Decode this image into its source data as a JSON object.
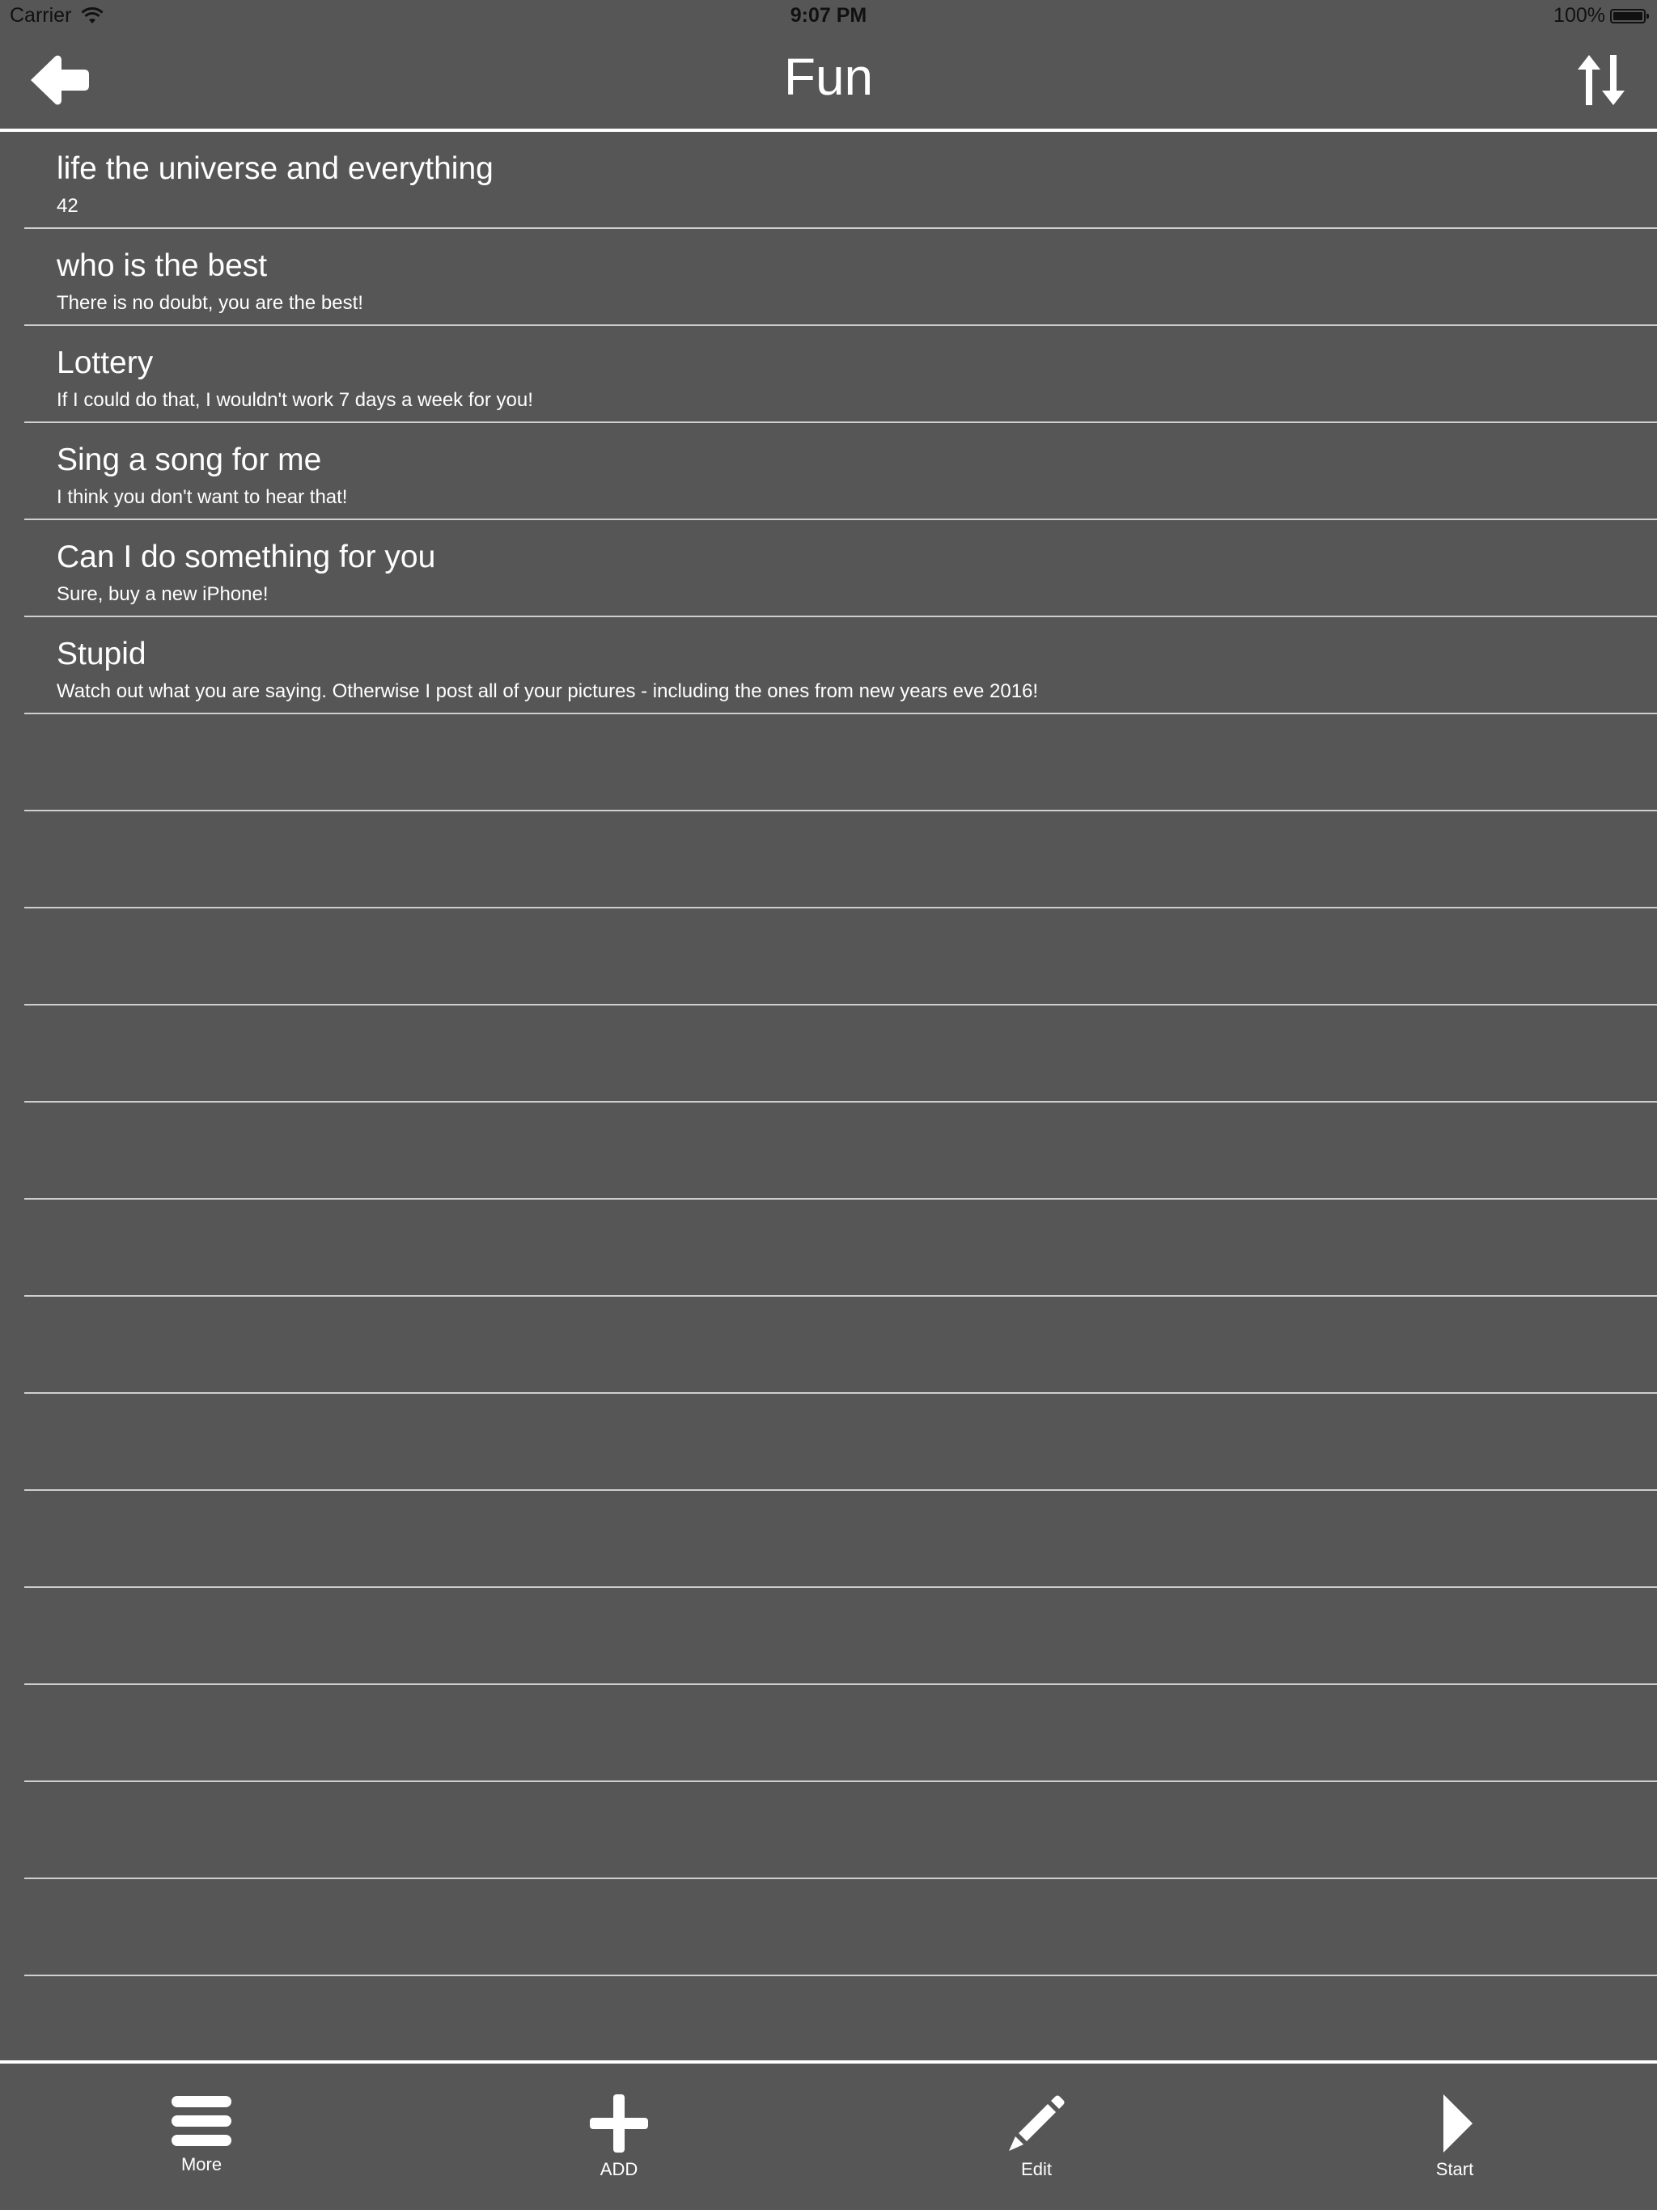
{
  "status_bar": {
    "carrier": "Carrier",
    "time": "9:07 PM",
    "battery": "100%"
  },
  "nav": {
    "title": "Fun",
    "back_icon": "arrow-left-icon",
    "sort_icon": "sort-updown-icon"
  },
  "list": {
    "items": [
      {
        "title": "life the universe and everything",
        "subtitle": "42"
      },
      {
        "title": "who is the best",
        "subtitle": "There is no doubt, you are the best!"
      },
      {
        "title": "Lottery",
        "subtitle": "If I could do that, I wouldn't work 7 days a week for you!"
      },
      {
        "title": "Sing a song for me",
        "subtitle": "I think you don't want to hear that!"
      },
      {
        "title": "Can I do something for you",
        "subtitle": "Sure, buy a new iPhone!"
      },
      {
        "title": "Stupid",
        "subtitle": "Watch out what you are saying. Otherwise I post all of your pictures - including the ones from new years eve 2016!"
      }
    ]
  },
  "toolbar": {
    "more_label": "More",
    "add_label": "ADD",
    "edit_label": "Edit",
    "start_label": "Start"
  },
  "colors": {
    "background": "#565656",
    "text": "#ffffff",
    "separator": "#cfcfcf"
  }
}
